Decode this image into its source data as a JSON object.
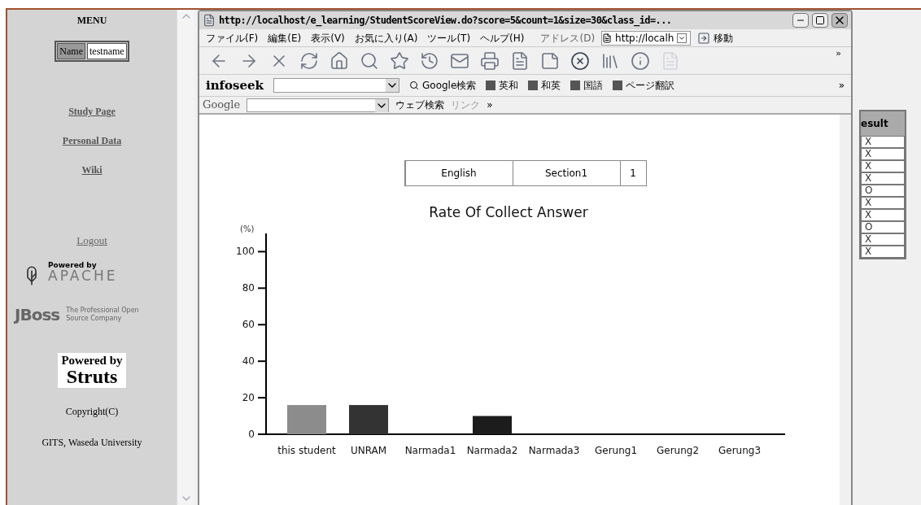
{
  "sidebar": {
    "title": "MENU",
    "name_label": "Name",
    "name_value": "testname",
    "links": [
      {
        "label": "Study Page",
        "bold": true
      },
      {
        "label": "Personal Data",
        "bold": true
      },
      {
        "label": "Wiki",
        "bold": true
      },
      {
        "label": "Logout",
        "bold": false
      }
    ],
    "logos": {
      "apache_top": "Powered by",
      "apache": "APACHE",
      "jboss": "JBoss",
      "jboss_tag": "The Professional Open Source Company",
      "struts_top": "Powered by",
      "struts": "Struts"
    },
    "copyright": "Copyright(C)",
    "org": "GITS, Waseda University"
  },
  "browser": {
    "title": "http://localhost/e_learning/StudentScoreView.do?score=5&count=1&size=30&class_id=...",
    "menu": [
      "ファイル(F)",
      "編集(E)",
      "表示(V)",
      "お気に入り(A)",
      "ツール(T)",
      "ヘルプ(H)"
    ],
    "address_label": "アドレス(D)",
    "address_value": "http://localh",
    "go": "移動",
    "infoseek": {
      "brand": "infoseek",
      "search": "Google検索",
      "buttons": [
        "英和",
        "和英",
        "国語",
        "ページ翻訳"
      ]
    },
    "google": {
      "brand": "Google",
      "search": "ウェブ検索",
      "links": "リンク"
    },
    "overflow": "»",
    "page": {
      "info": [
        "English",
        "Section1",
        "1"
      ],
      "chart_data": {
        "type": "bar",
        "title": "Rate Of Collect Answer",
        "ylabel": "(%)",
        "categories": [
          "this student",
          "UNRAM",
          "Narmada1",
          "Narmada2",
          "Narmada3",
          "Gerung1",
          "Gerung2",
          "Gerung3"
        ],
        "ylim": [
          0,
          110
        ],
        "yticks": [
          0,
          20,
          40,
          60,
          80,
          100
        ],
        "stacked": true,
        "series": [
          {
            "color": "#8c8c8c",
            "values": [
              16,
              null,
              null,
              null,
              null,
              null,
              null,
              null
            ]
          },
          {
            "color": "#333333",
            "values": [
              null,
              16,
              null,
              null,
              null,
              null,
              null,
              null
            ]
          },
          {
            "color": "#1c1c1c",
            "values": [
              null,
              null,
              0,
              10,
              0,
              0,
              0,
              0
            ]
          }
        ]
      }
    }
  },
  "result": {
    "header": "esult",
    "rows": [
      "X",
      "X",
      "X",
      "X",
      "O",
      "X",
      "X",
      "O",
      "X",
      "X"
    ]
  }
}
